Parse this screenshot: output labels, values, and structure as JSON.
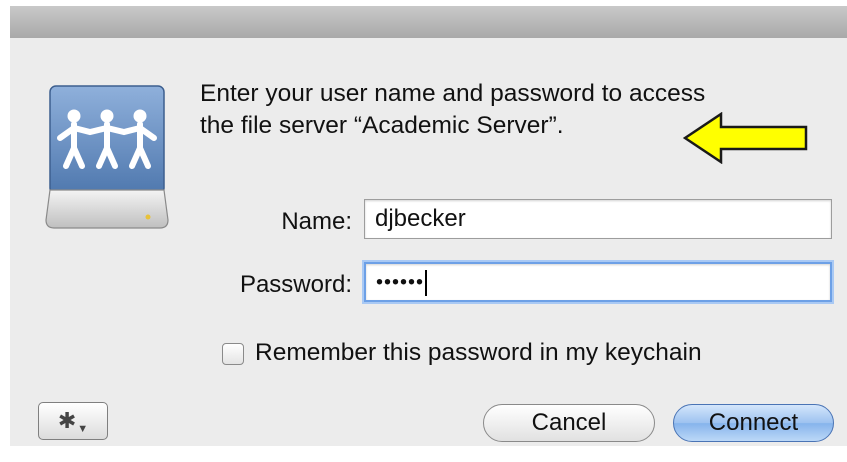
{
  "dialog": {
    "message_line1": "Enter your user name and password to access",
    "message_line2": "the file server “Academic Server”.",
    "name_label": "Name:",
    "name_value": "djbecker",
    "password_label": "Password:",
    "password_masked": "••••••",
    "remember_label": "Remember this password in my keychain",
    "remember_checked": false,
    "cancel_label": "Cancel",
    "connect_label": "Connect",
    "gear_glyph": "✱"
  },
  "icons": {
    "server": "file-server-drive-icon",
    "annotation": "yellow-arrow-left",
    "action": "gear-icon"
  },
  "colors": {
    "arrow_fill": "#ffff00",
    "default_button": "#9dc2f0",
    "focus_ring": "#6da0e6",
    "drive_blue": "#5f86ba"
  }
}
